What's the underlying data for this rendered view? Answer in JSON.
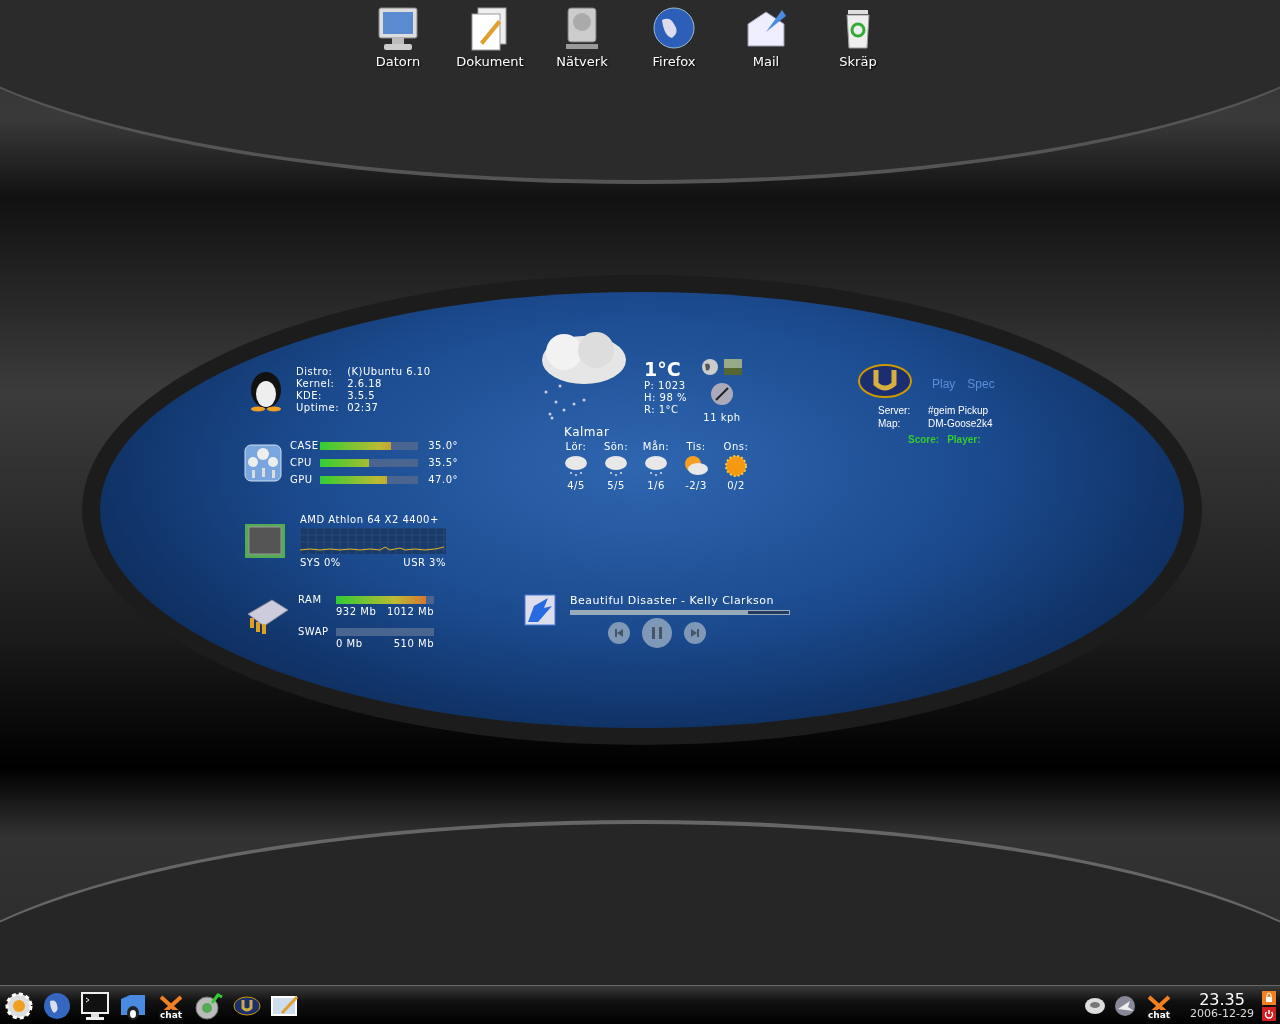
{
  "desktop_icons": [
    {
      "kind": "computer",
      "label": "Datorn"
    },
    {
      "kind": "documents",
      "label": "Dokument"
    },
    {
      "kind": "network",
      "label": "Nätverk"
    },
    {
      "kind": "browser",
      "label": "Firefox"
    },
    {
      "kind": "mail",
      "label": "Mail"
    },
    {
      "kind": "trash",
      "label": "Skräp"
    }
  ],
  "system_info": [
    {
      "label": "Distro:",
      "value": "(K)Ubuntu 6.10"
    },
    {
      "label": "Kernel:",
      "value": "2.6.18"
    },
    {
      "label": "KDE:",
      "value": "3.5.5"
    },
    {
      "label": "Uptime:",
      "value": "02:37"
    }
  ],
  "sensors": [
    {
      "label": "CASE",
      "level": 0.72,
      "reading": "35.0°"
    },
    {
      "label": "CPU",
      "level": 0.5,
      "reading": "35.5°"
    },
    {
      "label": "GPU",
      "level": 0.68,
      "reading": "47.0°"
    }
  ],
  "cpu": {
    "title": "AMD Athlon 64 X2 4400+",
    "sys": "SYS 0%",
    "usr": "USR 3%"
  },
  "memory": [
    {
      "label": "RAM",
      "level": 0.92,
      "used": "932 Mb",
      "total": "1012 Mb"
    },
    {
      "label": "SWAP",
      "level": 0,
      "used": "0 Mb",
      "total": "510 Mb"
    }
  ],
  "weather": {
    "temperature": "1°C",
    "details": [
      "P: 1023",
      "H: 98 %",
      "R: 1°C"
    ],
    "wind": "11 kph",
    "city": "Kalmar",
    "forecast": [
      {
        "day": "Lör:",
        "kind": "snow",
        "temps": "4/5"
      },
      {
        "day": "Sön:",
        "kind": "snow",
        "temps": "5/5"
      },
      {
        "day": "Mån:",
        "kind": "snow",
        "temps": "1/6"
      },
      {
        "day": "Tis:",
        "kind": "partly-sunny",
        "temps": "-2/3"
      },
      {
        "day": "Ons:",
        "kind": "sunny",
        "temps": "0/2"
      }
    ]
  },
  "game_server": {
    "links": [
      "Play",
      "Spec"
    ],
    "rows": [
      {
        "label": "Server:",
        "value": "#geim Pickup"
      },
      {
        "label": "Map:",
        "value": "DM-Goose2k4"
      }
    ],
    "score_label": "Score:",
    "player_label": "Player:"
  },
  "player": {
    "track": "Beautiful Disaster - Kelly Clarkson",
    "level": 0.81
  },
  "taskbar": {
    "launchers": [
      {
        "kind": "kde"
      },
      {
        "kind": "globe"
      },
      {
        "kind": "terminal"
      },
      {
        "kind": "home"
      },
      {
        "kind": "chat",
        "label": "chat"
      },
      {
        "kind": "music"
      },
      {
        "kind": "game"
      },
      {
        "kind": "editor"
      }
    ],
    "tray": [
      {
        "kind": "disc"
      },
      {
        "kind": "bird"
      },
      {
        "kind": "chat",
        "label": "chat"
      }
    ],
    "time": "23.35",
    "date": "2006-12-29"
  }
}
